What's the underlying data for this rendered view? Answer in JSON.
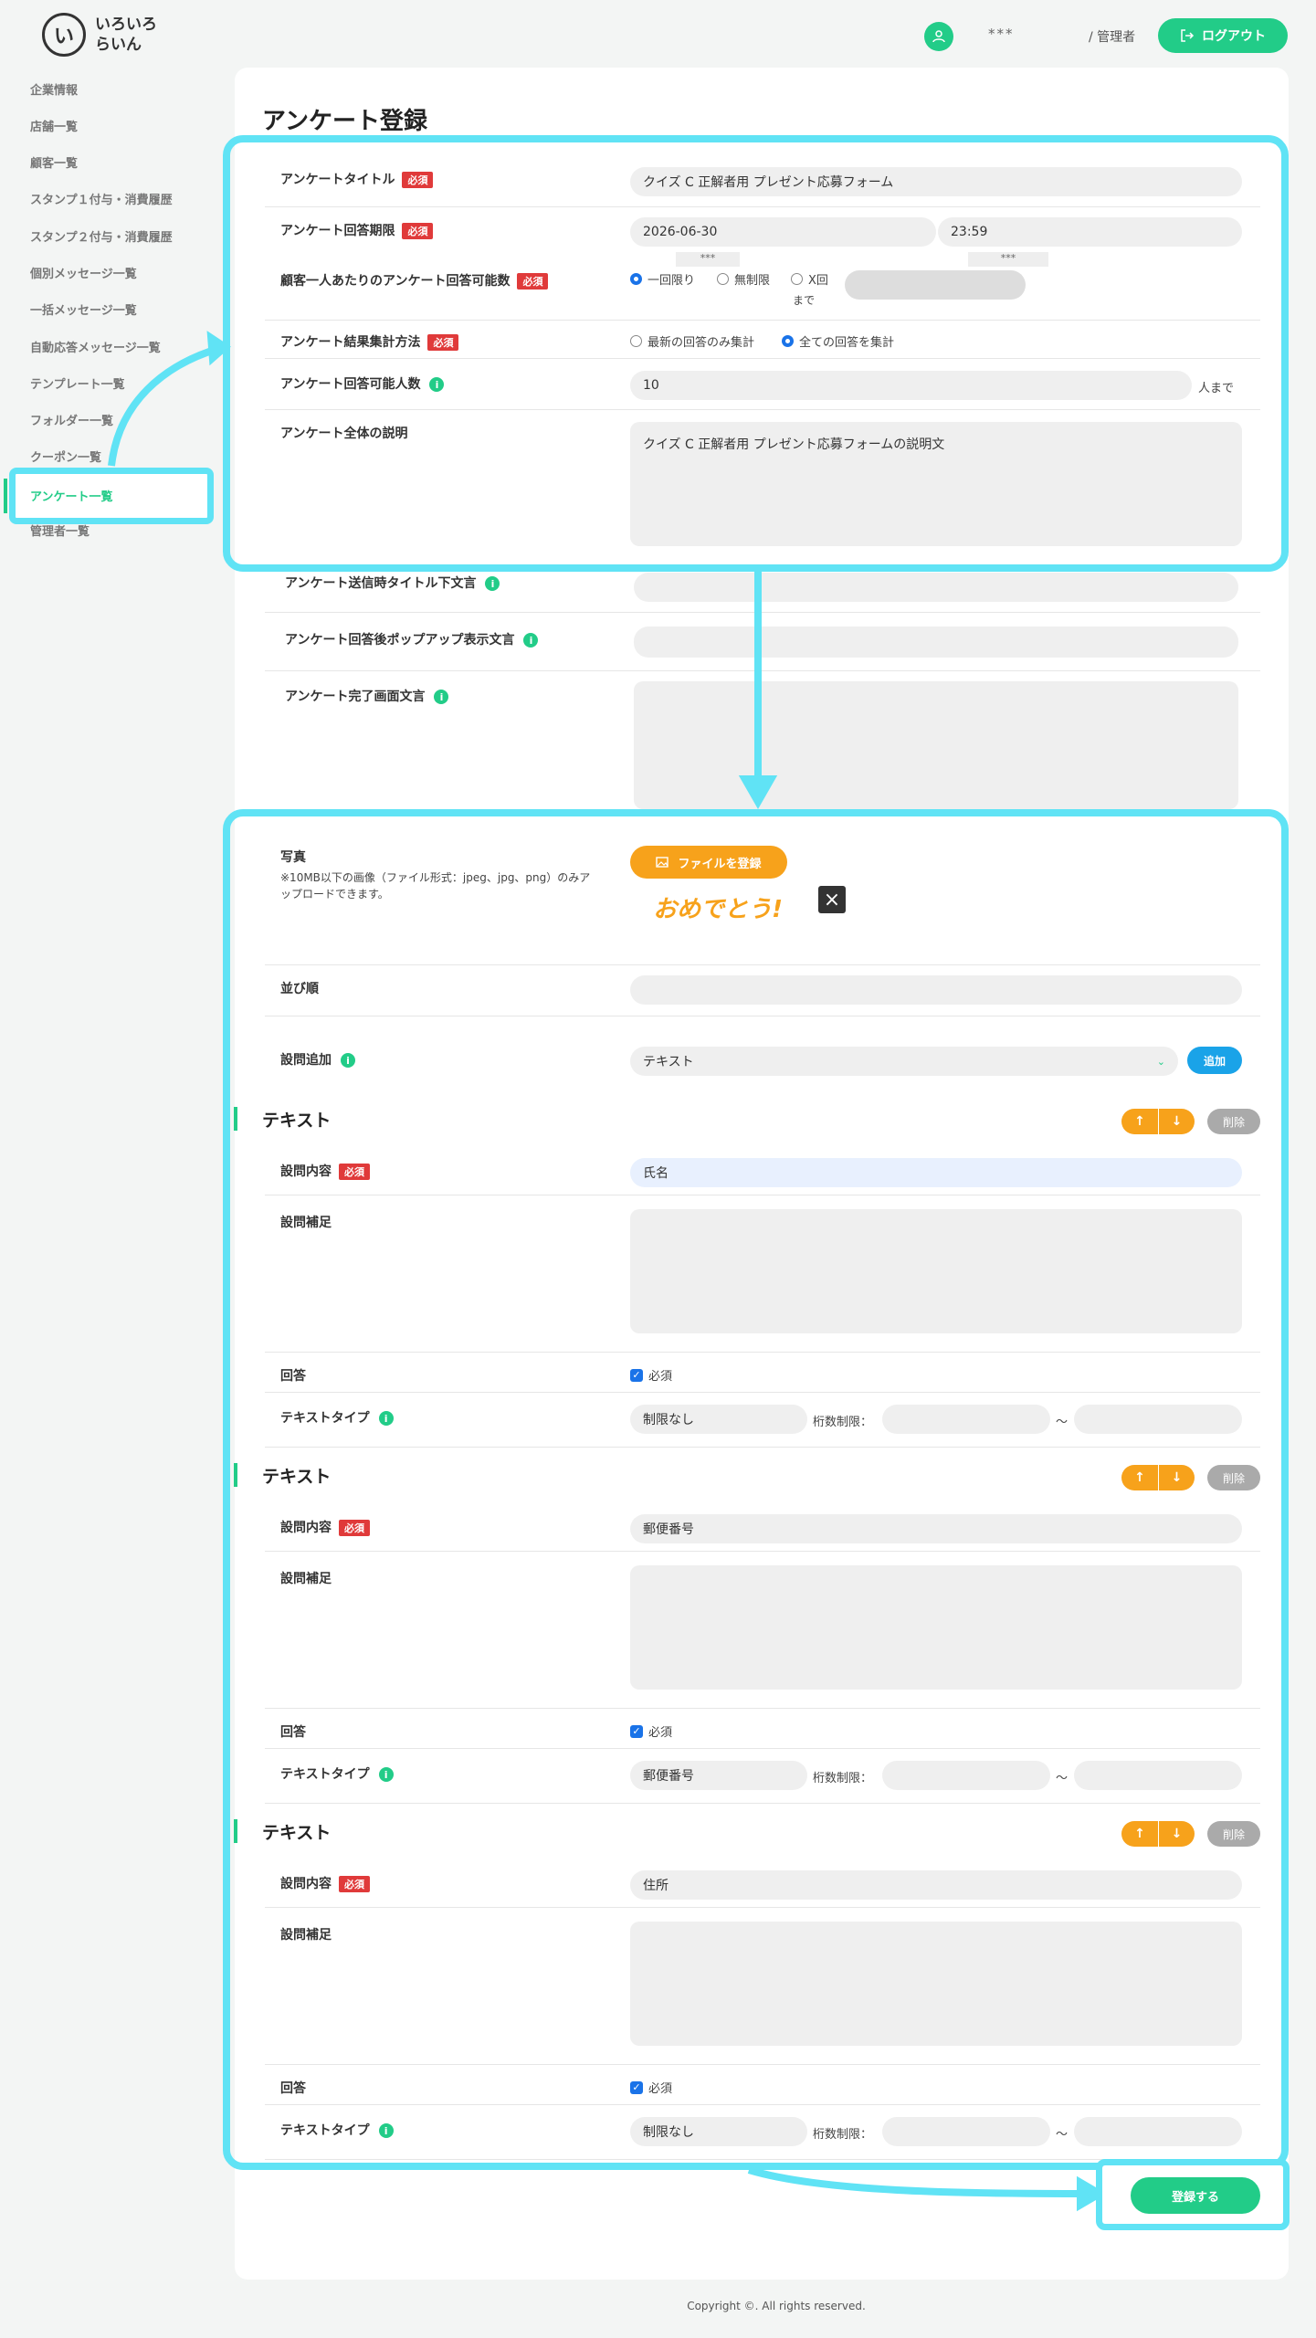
{
  "header": {
    "logo_mark": "い",
    "logo_text": "いろいろ らいん",
    "user_icon": "user-icon",
    "user_name": "***",
    "user_role": "/ 管理者",
    "logout_label": "ログアウト"
  },
  "sidebar": {
    "items": [
      {
        "label": "企業情報"
      },
      {
        "label": "店舗一覧"
      },
      {
        "label": "顧客一覧"
      },
      {
        "label": "スタンプ１付与・消費履歴"
      },
      {
        "label": "スタンプ２付与・消費履歴"
      },
      {
        "label": "個別メッセージ一覧"
      },
      {
        "label": "一括メッセージ一覧"
      },
      {
        "label": "自動応答メッセージ一覧"
      },
      {
        "label": "テンプレート一覧"
      },
      {
        "label": "フォルダー一覧"
      },
      {
        "label": "クーポン一覧"
      },
      {
        "label": "アンケート一覧"
      },
      {
        "label": "管理者一覧"
      }
    ],
    "active_index": 11
  },
  "form": {
    "page_title": "アンケート登録",
    "required_badge": "必須",
    "title_label": "アンケートタイトル",
    "title_value": "クイズ C 正解者用 プレゼント応募フォーム",
    "deadline_label": "アンケート回答期限",
    "deadline_date": "2026-06-30",
    "deadline_time": "23:59",
    "hidden_a": "***",
    "hidden_b": "***",
    "per_customer_label": "顧客一人あたりのアンケート回答可能数",
    "per_customer_options": [
      "一回限り",
      "無制限",
      "X回"
    ],
    "per_customer_selected": "一回限り",
    "per_customer_until": "まで",
    "aggregation_label": "アンケート結果集計方法",
    "aggregation_options": [
      "最新の回答のみ集計",
      "全ての回答を集計"
    ],
    "aggregation_selected": "全ての回答を集計",
    "capacity_label": "アンケート回答可能人数",
    "capacity_value": "10",
    "capacity_suffix": "人まで",
    "description_label": "アンケート全体の説明",
    "description_value": "クイズ C 正解者用 プレゼント応募フォームの説明文",
    "send_title_label": "アンケート送信時タイトル下文言",
    "popup_label": "アンケート回答後ポップアップ表示文言",
    "complete_label": "アンケート完了画面文言",
    "photo_label": "写真",
    "photo_note": "※10MB以下の画像（ファイル形式：jpeg、jpg、png）のみアップロードできます。",
    "file_button": "ファイルを登録",
    "photo_image_text": "おめでとう!",
    "order_label": "並び順",
    "add_question_label": "設問追加",
    "add_question_select": "テキスト",
    "add_button": "追加",
    "submit_button": "登録する"
  },
  "question_labels": {
    "content": "設問内容",
    "supplement": "設問補足",
    "answer": "回答",
    "answer_required": "必須",
    "text_type": "テキストタイプ",
    "digit_limit": "桁数制限：",
    "tilde": "〜",
    "delete": "削除"
  },
  "questions": [
    {
      "section_title": "テキスト",
      "content": "氏名",
      "text_type": "制限なし"
    },
    {
      "section_title": "テキスト",
      "content": "郵便番号",
      "text_type": "郵便番号"
    },
    {
      "section_title": "テキスト",
      "content": "住所",
      "text_type": "制限なし"
    }
  ],
  "footer": {
    "copyright": "Copyright ©. All rights reserved."
  }
}
